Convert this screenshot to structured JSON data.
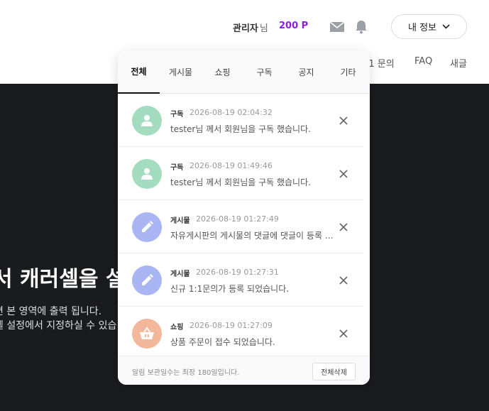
{
  "header": {
    "user_name": "관리자",
    "user_suffix": "님",
    "points": "200 P",
    "myinfo_label": "내 정보",
    "nav": {
      "qna": ":1 문의",
      "faq": "FAQ",
      "rent": "새글"
    }
  },
  "hero": {
    "title": "서 캐러셀을 설",
    "line1": "면 본 영역에 출력 됩니다.",
    "line2": "셀 설정에서 지정하실 수 있습"
  },
  "popup": {
    "tabs": [
      "전체",
      "게시물",
      "쇼핑",
      "구독",
      "공지",
      "기타"
    ],
    "active_tab": "전체",
    "items": [
      {
        "category": "구독",
        "date": "2026-08-19 02:04:32",
        "text": "tester님 께서 회원님을 구독 했습니다.",
        "icon": "user-icon",
        "color": "#a3dcbf"
      },
      {
        "category": "구독",
        "date": "2026-08-19 01:49:46",
        "text": "tester님 께서 회원님을 구독 했습니다.",
        "icon": "user-icon",
        "color": "#a3dcbf"
      },
      {
        "category": "게시물",
        "date": "2026-08-19 01:27:49",
        "text": "자유게시판의 게시물의 댓글에 댓글이 등록 되었습니다.",
        "icon": "pencil-icon",
        "color": "#a9b6f3"
      },
      {
        "category": "게시물",
        "date": "2026-08-19 01:27:31",
        "text": "신규 1:1문의가 등록 되었습니다.",
        "icon": "pencil-icon",
        "color": "#a9b6f3"
      },
      {
        "category": "쇼핑",
        "date": "2026-08-19 01:27:09",
        "text": "상품 주문이 접수 되었습니다.",
        "icon": "basket-icon",
        "color": "#f3b89c"
      }
    ],
    "footer_note": "알림 보관일수는 최장 180일입니다.",
    "delete_all_label": "전체삭제"
  },
  "colors": {
    "accent_points": "#8a1fe0",
    "hero_bg": "#1a1b1e"
  }
}
